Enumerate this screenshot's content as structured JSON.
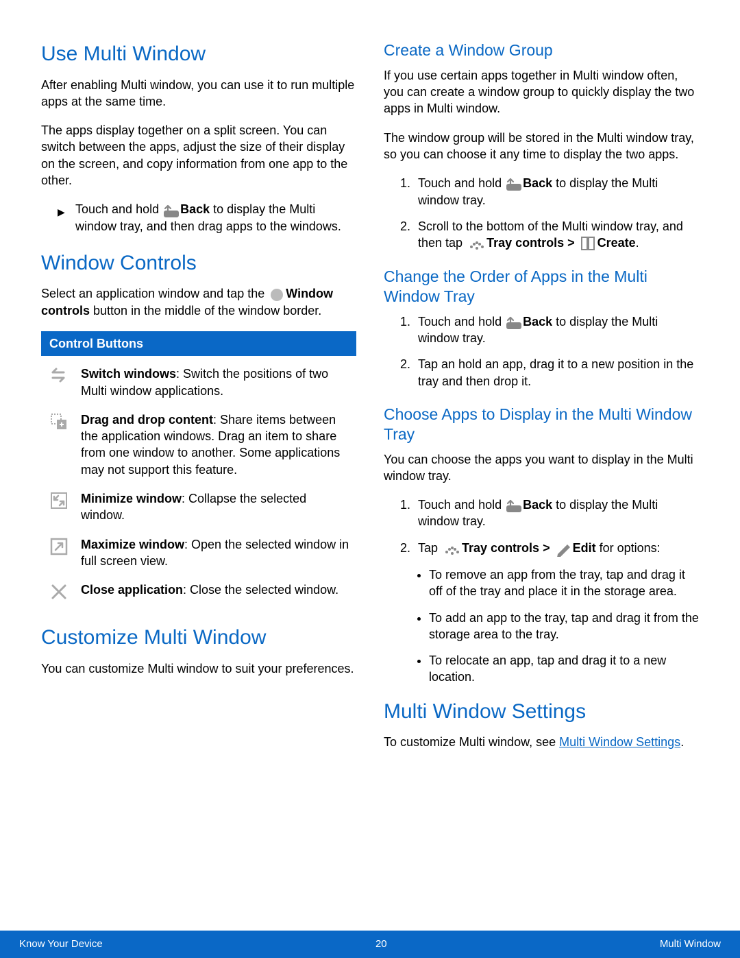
{
  "left": {
    "h_use": "Use Multi Window",
    "p_use1": "After enabling Multi window, you can use it to run multiple apps at the same time.",
    "p_use2": "The apps display together on a split screen. You can switch between the apps, adjust the size of their display on the screen, and copy information from one app to the other.",
    "step_use_pre": "Touch and hold ",
    "step_use_bold": "Back",
    "step_use_post": " to display the Multi window tray, and then drag apps to the windows.",
    "h_ctrl": "Window Controls",
    "p_ctrl_pre": "Select an application window and tap the ",
    "p_ctrl_bold": "Window controls",
    "p_ctrl_post": " button in the middle of the window border.",
    "ctrl_header": "Control Buttons",
    "ctrl": [
      {
        "name": "Switch windows",
        "desc": ": Switch the positions of two Multi window applications."
      },
      {
        "name": "Drag and drop content",
        "desc": ": Share items between the application windows. Drag an item to share from one window to another. Some applications may not support this feature."
      },
      {
        "name": "Minimize window",
        "desc": ": Collapse the selected window."
      },
      {
        "name": "Maximize window",
        "desc": ": Open the selected window in full screen view."
      },
      {
        "name": "Close application",
        "desc": ": Close the selected window."
      }
    ],
    "h_custom": "Customize Multi Window",
    "p_custom": "You can customize Multi window to suit your preferences."
  },
  "right": {
    "h_group": "Create a Window Group",
    "p_group1": "If you use certain apps together in Multi window often, you can create a window group to quickly display the two apps in Multi window.",
    "p_group2": "The window group will be stored in the Multi window tray, so you can choose it any time to display the two apps.",
    "group_s1_pre": "Touch and hold ",
    "group_s1_bold": "Back",
    "group_s1_post": " to display the Multi window tray.",
    "group_s2_pre": "Scroll to the bottom of the Multi window tray, and then tap ",
    "group_s2_bold1": "Tray controls > ",
    "group_s2_bold2": "Create",
    "h_order": "Change the Order of Apps in the Multi Window Tray",
    "order_s1_pre": "Touch and hold ",
    "order_s1_bold": "Back",
    "order_s1_post": " to display the Multi window tray.",
    "order_s2": "Tap an hold an app, drag it to a new position in the tray and then drop it.",
    "h_choose": "Choose Apps to Display in the Multi Window Tray",
    "p_choose": "You can choose the apps you want to display in the Multi window tray.",
    "choose_s1_pre": "Touch and hold ",
    "choose_s1_bold": "Back",
    "choose_s1_post": " to display the Multi window tray.",
    "choose_s2_pre": "Tap ",
    "choose_s2_bold1": "Tray controls > ",
    "choose_s2_bold2": "Edit",
    "choose_s2_post": " for options:",
    "bullets": [
      "To remove an app from the tray, tap and drag it off of the tray and place it in the storage area.",
      "To add an app to the tray, tap and drag it from the storage area to the tray.",
      "To relocate an app, tap and drag it to a new location."
    ],
    "h_settings": "Multi Window Settings",
    "p_settings_pre": "To customize Multi window, see ",
    "link_settings": "Multi Window Settings",
    "dot": "."
  },
  "footer": {
    "left": "Know Your Device",
    "center": "20",
    "right": "Multi Window"
  }
}
